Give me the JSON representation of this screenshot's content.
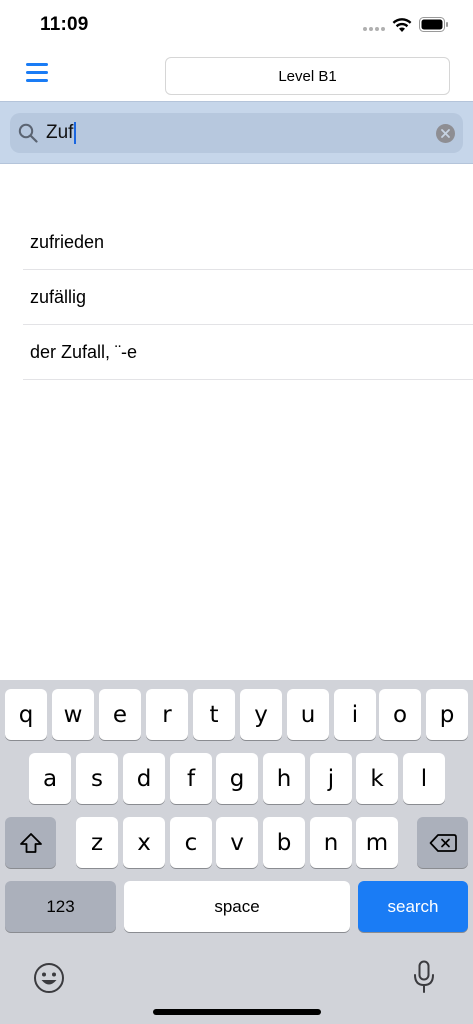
{
  "status_bar": {
    "time": "11:09"
  },
  "nav": {
    "level_label": "Level B1"
  },
  "search": {
    "value": "Zuf"
  },
  "results": [
    "zufrieden",
    "zufällig",
    "der Zufall, ¨-e"
  ],
  "keyboard": {
    "row1": [
      "q",
      "w",
      "e",
      "r",
      "t",
      "y",
      "u",
      "i",
      "o",
      "p"
    ],
    "row2": [
      "a",
      "s",
      "d",
      "f",
      "g",
      "h",
      "j",
      "k",
      "l"
    ],
    "row3": [
      "z",
      "x",
      "c",
      "v",
      "b",
      "n",
      "m"
    ],
    "numbers_label": "123",
    "space_label": "space",
    "search_label": "search"
  },
  "icons": {
    "menu": "hamburger-icon",
    "search": "magnifier-icon",
    "clear": "clear-icon",
    "shift": "shift-icon",
    "delete": "backspace-icon",
    "emoji": "emoji-icon",
    "mic": "microphone-icon"
  },
  "colors": {
    "accent": "#1a7cf5",
    "search_bg": "#c6d6ea"
  }
}
